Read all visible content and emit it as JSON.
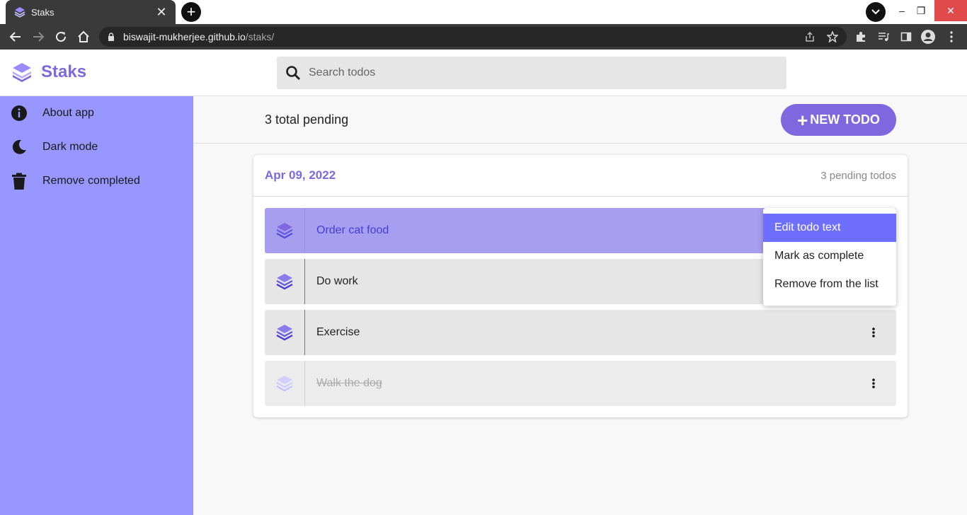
{
  "browser": {
    "tab_title": "Staks",
    "tab_close": "✕",
    "new_tab": "+",
    "url_host": "biswajit-mukherjee.github.io",
    "url_path": "/staks/",
    "window_controls": [
      "–",
      "❐",
      "✕"
    ]
  },
  "app": {
    "brand": "Staks",
    "search": {
      "placeholder": "Search todos",
      "value": ""
    },
    "sidebar": {
      "items": [
        {
          "label": "About app",
          "icon": "info-icon"
        },
        {
          "label": "Dark mode",
          "icon": "moon-icon"
        },
        {
          "label": "Remove completed",
          "icon": "trash-icon"
        }
      ]
    },
    "summary": {
      "pending_text": "3 total pending",
      "new_button": "NEW TODO",
      "new_button_icon": "+"
    },
    "group": {
      "date": "Apr 09, 2022",
      "meta": "3 pending todos",
      "todos": [
        {
          "text": "Order cat food",
          "state": "active"
        },
        {
          "text": "Do work",
          "state": "pending"
        },
        {
          "text": "Exercise",
          "state": "pending"
        },
        {
          "text": "Walk the dog",
          "state": "completed"
        }
      ]
    },
    "context_menu": {
      "items": [
        {
          "label": "Edit todo text",
          "highlighted": true
        },
        {
          "label": "Mark as complete",
          "highlighted": false
        },
        {
          "label": "Remove from the list",
          "highlighted": false
        }
      ]
    }
  },
  "colors": {
    "brand": "#7e68e0",
    "sidebar": "#9797ff",
    "menu_highlight": "#6f6fff"
  }
}
